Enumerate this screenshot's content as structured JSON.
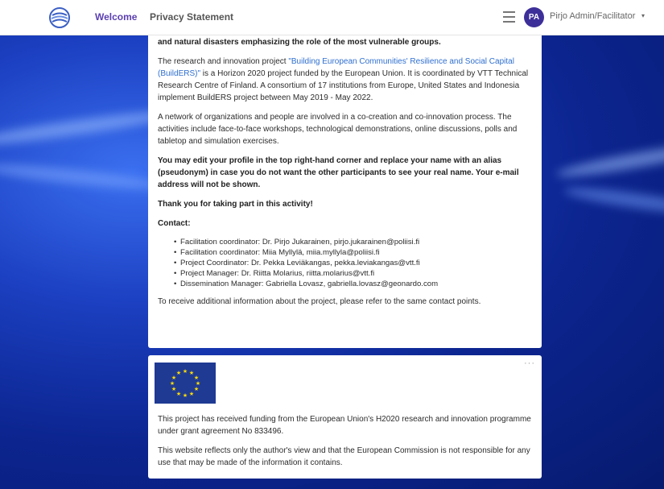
{
  "nav": {
    "welcome": "Welcome",
    "privacy": "Privacy Statement",
    "avatar_initials": "PA",
    "user_name": "Pirjo Admin/Facilitator",
    "caret": "▾"
  },
  "main": {
    "intro_bold": "and natural disasters emphasizing the role of the most vulnerable groups.",
    "p1_pre": "The research and innovation project ",
    "p1_link": "\"Building European Communities' Resilience and Social Capital (BuildERS)\"",
    "p1_post": " is a Horizon 2020 project funded by the European Union. It is coordinated by VTT Technical Research Centre of Finland. A consortium of 17 institutions from Europe, United States and Indonesia implement BuildERS project between May 2019 - May 2022.",
    "p2": "A network of organizations and people are involved in a co-creation and co-innovation process. The activities include face-to-face workshops, technological demonstrations, online discussions, polls and tabletop and simulation exercises.",
    "p3_bold": "You may edit your profile in the top right-hand corner and replace your name with an alias (pseudonym) in case you do not want the other participants to see your real name. Your e-mail address will not be shown.",
    "thanks": "Thank you for taking part in this activity!",
    "contact_heading": "Contact:",
    "contacts": [
      "Facilitation coordinator: Dr. Pirjo Jukarainen, pirjo.jukarainen@poliisi.fi",
      "Facilitation coordinator: Miia Myllylä, miia.myllyla@poliisi.fi",
      "Project Coordinator: Dr. Pekka Leviäkangas, pekka.leviakangas@vtt.fi",
      "Project Manager: Dr. Riitta Molarius, riitta.molarius@vtt.fi",
      "Dissemination Manager: Gabriella Lovasz, gabriella.lovasz@geonardo.com"
    ],
    "closing": "To receive additional information about the project, please refer to the same contact points."
  },
  "funding": {
    "menu_dots": "···",
    "p1": "This project has received funding from the European Union's H2020 research and innovation programme under grant agreement No 833496.",
    "p2": "This website reflects only the author's view and that the European Commission is not responsible for any use that may be made of the information it contains."
  },
  "colors": {
    "accent": "#5b3fb0",
    "avatar": "#3d2f99",
    "link": "#2f6fd0",
    "eu_blue": "#1f3a93",
    "eu_star": "#ffdd00"
  }
}
